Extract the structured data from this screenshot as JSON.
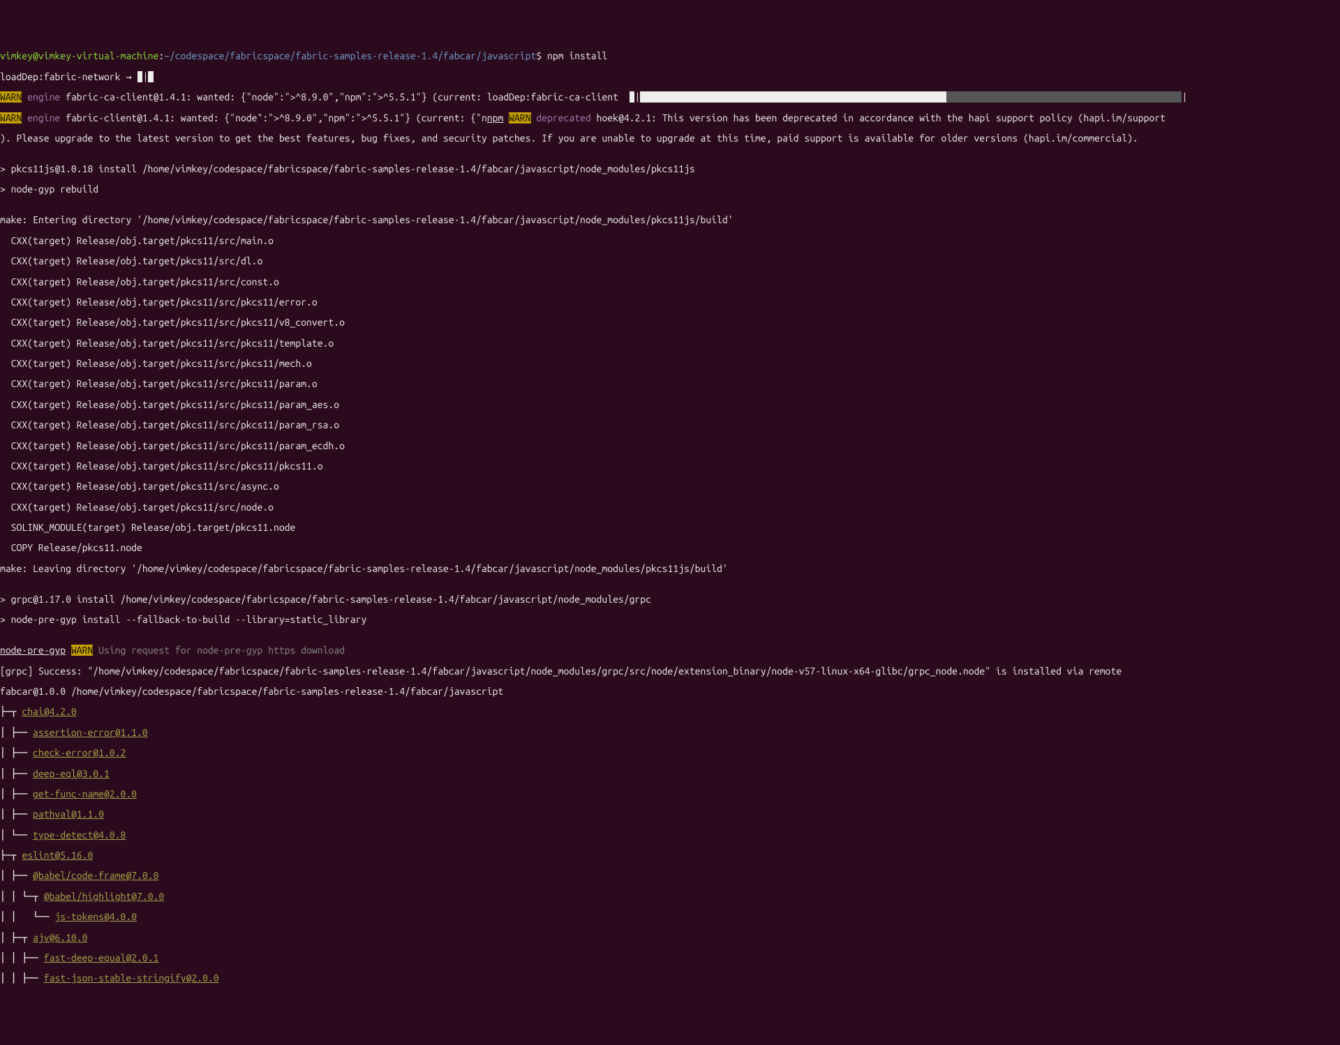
{
  "user_host": "vimkey@vimkey-virtual-machine",
  "colon": ":",
  "cwd": "~/codespace/fabricspace/fabric-samples-release-1.4/fabcar/javascript",
  "prompt_dollar": "$",
  "cmd": " npm install",
  "loaddep1": "loadDep:fabric-network → ",
  "bar1a": " ",
  "bar1b": "|",
  "bar1c": " ",
  "warn": "WARN",
  "engine_lbl": " engine",
  "warn1_rest": " fabric-ca-client@1.4.1: wanted: {\"node\":\">^8.9.0\",\"npm\":\">^5.5.1\"} (current: loadDep:fabric-ca-client  ",
  "bar2a_pre": " ",
  "bar2b": "|",
  "bar2c_white": "                                                        ",
  "bar2d_dark": "                                           ",
  "bar2e": "|",
  "warn2_rest_a": " fabric-client@1.4.1: wanted: {\"node\":\">^8.9.0\",\"npm\":\">^5.5.1\"} (current: {\"n",
  "npm_lbl": "npm",
  "dep_lbl": " deprecated",
  "warn2_rest_b": " hoek@4.2.1: This version has been deprecated in accordance with the hapi support policy (hapi.im/support",
  "warn2_cont": "). Please upgrade to the latest version to get the best features, bug fixes, and security patches. If you are unable to upgrade at this time, paid support is available for older versions (hapi.im/commercial).",
  "blank": "",
  "pk_install": "> pkcs11js@1.0.18 install /home/vimkey/codespace/fabricspace/fabric-samples-release-1.4/fabcar/javascript/node_modules/pkcs11js",
  "node_gyp": "> node-gyp rebuild",
  "make_enter": "make: Entering directory '/home/vimkey/codespace/fabricspace/fabric-samples-release-1.4/fabcar/javascript/node_modules/pkcs11js/build'",
  "cxx1": "  CXX(target) Release/obj.target/pkcs11/src/main.o",
  "cxx2": "  CXX(target) Release/obj.target/pkcs11/src/dl.o",
  "cxx3": "  CXX(target) Release/obj.target/pkcs11/src/const.o",
  "cxx4": "  CXX(target) Release/obj.target/pkcs11/src/pkcs11/error.o",
  "cxx5": "  CXX(target) Release/obj.target/pkcs11/src/pkcs11/v8_convert.o",
  "cxx6": "  CXX(target) Release/obj.target/pkcs11/src/pkcs11/template.o",
  "cxx7": "  CXX(target) Release/obj.target/pkcs11/src/pkcs11/mech.o",
  "cxx8": "  CXX(target) Release/obj.target/pkcs11/src/pkcs11/param.o",
  "cxx9": "  CXX(target) Release/obj.target/pkcs11/src/pkcs11/param_aes.o",
  "cxx10": "  CXX(target) Release/obj.target/pkcs11/src/pkcs11/param_rsa.o",
  "cxx11": "  CXX(target) Release/obj.target/pkcs11/src/pkcs11/param_ecdh.o",
  "cxx12": "  CXX(target) Release/obj.target/pkcs11/src/pkcs11/pkcs11.o",
  "cxx13": "  CXX(target) Release/obj.target/pkcs11/src/async.o",
  "cxx14": "  CXX(target) Release/obj.target/pkcs11/src/node.o",
  "solink": "  SOLINK_MODULE(target) Release/obj.target/pkcs11.node",
  "copy": "  COPY Release/pkcs11.node",
  "make_leave": "make: Leaving directory '/home/vimkey/codespace/fabricspace/fabric-samples-release-1.4/fabcar/javascript/node_modules/pkcs11js/build'",
  "grpc_install": "> grpc@1.17.0 install /home/vimkey/codespace/fabricspace/fabric-samples-release-1.4/fabcar/javascript/node_modules/grpc",
  "grpc_npg": "> node-pre-gyp install --fallback-to-build --library=static_library",
  "npg_lbl": "node-pre-gyp",
  "npg_rest": " Using request for node-pre-gyp https download",
  "grpc_success": "[grpc] Success: \"/home/vimkey/codespace/fabricspace/fabric-samples-release-1.4/fabcar/javascript/node_modules/grpc/src/node/extension_binary/node-v57-linux-x64-glibc/grpc_node.node\" is installed via remote",
  "fabcar_path": "fabcar@1.0.0 /home/vimkey/codespace/fabricspace/fabric-samples-release-1.4/fabcar/javascript",
  "tree": {
    "l0": "├─┬ ",
    "l0t": "chai@4.2.0",
    "l1": "│ ├── ",
    "l1t": "assertion-error@1.1.0",
    "l2": "│ ├── ",
    "l2t": "check-error@1.0.2",
    "l3": "│ ├── ",
    "l3t": "deep-eql@3.0.1",
    "l4": "│ ├── ",
    "l4t": "get-func-name@2.0.0",
    "l5": "│ ├── ",
    "l5t": "pathval@1.1.0",
    "l6": "│ └── ",
    "l6t": "type-detect@4.0.8",
    "l7": "├─┬ ",
    "l7t": "eslint@5.16.0",
    "l8": "│ ├── ",
    "l8t": "@babel/code-frame@7.0.0",
    "l9": "│ │ └─┬ ",
    "l9t": "@babel/highlight@7.0.0",
    "l10": "│ │   └── ",
    "l10t": "js-tokens@4.0.0",
    "l11": "│ ├─┬ ",
    "l11t": "ajv@6.10.0",
    "l12": "│ │ ├── ",
    "l12t": "fast-deep-equal@2.0.1",
    "l13": "│ │ ├── ",
    "l13t": "fast-json-stable-stringify@2.0.0"
  }
}
